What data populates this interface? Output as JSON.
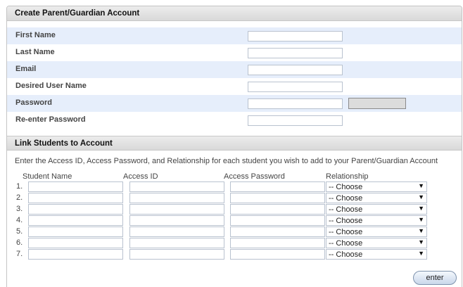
{
  "account": {
    "title": "Create Parent/Guardian Account",
    "fields": [
      {
        "label": "First Name",
        "value": ""
      },
      {
        "label": "Last Name",
        "value": ""
      },
      {
        "label": "Email",
        "value": ""
      },
      {
        "label": "Desired User Name",
        "value": ""
      },
      {
        "label": "Password",
        "value": ""
      },
      {
        "label": "Re-enter Password",
        "value": ""
      }
    ]
  },
  "link": {
    "title": "Link Students to Account",
    "instructions": "Enter the Access ID, Access Password, and Relationship for each student you wish to add to your Parent/Guardian Account",
    "columns": {
      "student_name": "Student Name",
      "access_id": "Access ID",
      "access_password": "Access Password",
      "relationship": "Relationship"
    },
    "rows": [
      {
        "num": "1.",
        "relationship": "-- Choose"
      },
      {
        "num": "2.",
        "relationship": "-- Choose"
      },
      {
        "num": "3.",
        "relationship": "-- Choose"
      },
      {
        "num": "4.",
        "relationship": "-- Choose"
      },
      {
        "num": "5.",
        "relationship": "-- Choose"
      },
      {
        "num": "6.",
        "relationship": "-- Choose"
      },
      {
        "num": "7.",
        "relationship": "-- Choose"
      }
    ],
    "dropdown_arrow": "▼"
  },
  "actions": {
    "enter_label": "enter"
  },
  "colors": {
    "row_shade": "#e6eefb",
    "header_bg": "#d9d9d9",
    "button_border": "#7f93ad"
  }
}
